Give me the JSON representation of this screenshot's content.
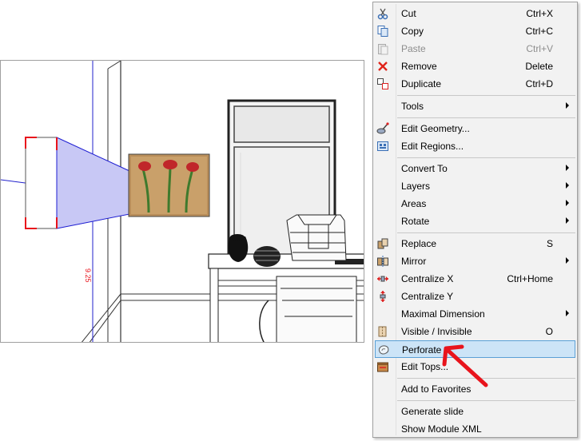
{
  "menu": {
    "items": [
      {
        "label": "Cut",
        "shortcut": "Ctrl+X",
        "icon": "scissors-icon"
      },
      {
        "label": "Copy",
        "shortcut": "Ctrl+C",
        "icon": "copy-icon"
      },
      {
        "label": "Paste",
        "shortcut": "Ctrl+V",
        "icon": "paste-icon",
        "disabled": true
      },
      {
        "label": "Remove",
        "shortcut": "Delete",
        "icon": "remove-x-icon"
      },
      {
        "label": "Duplicate",
        "shortcut": "Ctrl+D",
        "icon": "duplicate-icon"
      },
      {
        "label": "Tools",
        "submenu": true
      },
      {
        "label": "Edit Geometry...",
        "icon": "edit-geometry-icon"
      },
      {
        "label": "Edit Regions...",
        "icon": "edit-regions-icon"
      },
      {
        "label": "Convert To",
        "submenu": true
      },
      {
        "label": "Layers",
        "submenu": true
      },
      {
        "label": "Areas",
        "submenu": true
      },
      {
        "label": "Rotate",
        "submenu": true
      },
      {
        "label": "Replace",
        "shortcut": "S",
        "icon": "replace-icon"
      },
      {
        "label": "Mirror",
        "submenu": true,
        "icon": "mirror-icon"
      },
      {
        "label": "Centralize X",
        "shortcut": "Ctrl+Home",
        "icon": "centralize-x-icon"
      },
      {
        "label": "Centralize Y",
        "icon": "centralize-y-icon"
      },
      {
        "label": "Maximal Dimension",
        "submenu": true
      },
      {
        "label": "Visible / Invisible",
        "shortcut": "O",
        "icon": "visibility-icon"
      },
      {
        "label": "Perforate",
        "icon": "perforate-icon",
        "highlighted": true
      },
      {
        "label": "Edit Tops...",
        "icon": "edit-tops-icon"
      },
      {
        "label": "Add to Favorites"
      },
      {
        "label": "Generate slide"
      },
      {
        "label": "Show Module XML"
      }
    ]
  },
  "colors": {
    "highlight_bg": "#cce4f7",
    "highlight_border": "#5aa0d6",
    "annotation_arrow": "#e8141c",
    "selection_fill": "#c8c8f5",
    "selection_stroke": "#1e1ed2"
  },
  "viewport": {
    "dimension_label": "9.25"
  }
}
